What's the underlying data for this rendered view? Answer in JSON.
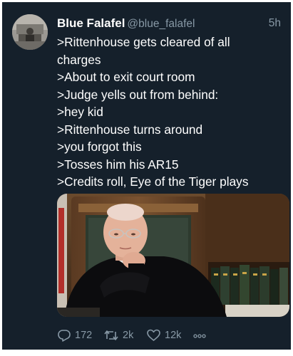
{
  "tweet": {
    "author": {
      "display_name": "Blue Falafel",
      "handle": "@blue_falafel"
    },
    "timestamp": "5h",
    "text_lines": [
      ">Rittenhouse gets cleared of all",
      "charges",
      ">About to exit court room",
      ">Judge yells out from behind:",
      ">hey kid",
      ">Rittenhouse turns around",
      ">you forgot this",
      ">Tosses him his AR15",
      ">Credits roll, Eye of the Tiger plays"
    ],
    "actions": {
      "replies": {
        "icon": "reply-icon",
        "count": "172"
      },
      "retweets": {
        "icon": "retweet-icon",
        "count": "2k"
      },
      "likes": {
        "icon": "heart-icon",
        "count": "12k"
      },
      "share": {
        "icon": "more-icon"
      }
    }
  },
  "colors": {
    "background": "#15202b",
    "text": "#ffffff",
    "secondary_text": "#8899a6"
  }
}
